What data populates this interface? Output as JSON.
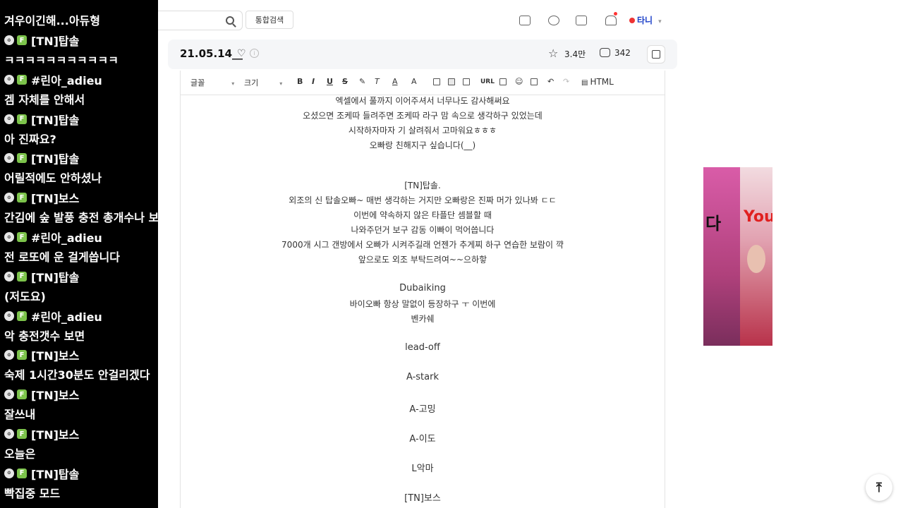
{
  "chat": {
    "top_partial": "겨우이긴해...아듀형",
    "messages": [
      {
        "user": "[TN]탑솔",
        "text": "ㅋㅋㅋㅋㅋㅋㅋㅋㅋㅋㅋ"
      },
      {
        "user": "#린아_adieu",
        "text": "겜 자체를 안해서"
      },
      {
        "user": "[TN]탑솔",
        "text": "아 진짜요?"
      },
      {
        "user": "[TN]탑솔",
        "text": "어릴적에도 안하셨나"
      },
      {
        "user": "[TN]보스",
        "text": "간김에 숲 발풍 충전 총개수나 보고와야겠다"
      },
      {
        "user": "#린아_adieu",
        "text": "전 로또에 운 걸게씁니다"
      },
      {
        "user": "[TN]탑솔",
        "text": "(저도요)"
      },
      {
        "user": "#린아_adieu",
        "text": "악 충전갯수 보면"
      },
      {
        "user": "[TN]보스",
        "text": "숙제 1시간30분도 안걸리겠다"
      },
      {
        "user": "[TN]보스",
        "text": "잘쓰내"
      },
      {
        "user": "[TN]보스",
        "text": "오늘은"
      },
      {
        "user": "[TN]탑솔",
        "text": "빡집중 모드"
      }
    ]
  },
  "topbar": {
    "search_button": "통합검색",
    "user_name": "타니"
  },
  "post": {
    "title": "21.05.14__",
    "likes": "3.4만",
    "views": "342"
  },
  "toolbar": {
    "font": "글꼴",
    "size": "크기",
    "bold": "B",
    "italic": "I",
    "underline": "U",
    "strike": "S",
    "url": "URL",
    "html": "HTML"
  },
  "content_lines": [
    "엑셀에서 풀까지 이어주셔서 너무나도 감사해써요",
    "오셨으면 조케따 들려주면 조케따 라구 맘 속으로 생각하구 있었는데",
    "시작하자마자 기 살려줘서 고마워요ㅎㅎㅎ",
    "오빠랑 친해지구 싶습니다(__)",
    "[TN]탑솔.",
    "외조의 신 탑솔오빠~ 매번 생각하는 거지만 오빠랑은 진짜 머가 있나봐 ㄷㄷ",
    "이번에 약속하지 않은 타플단 셈블할 때",
    "나와주던거 보구 감동 이빠이 먹어씁니다",
    "7000개 시그 갠방에서 오빠가 시켜주길래 언젠가 추게찌 하구 연습한 보람이 꺅",
    "앞으로도 외조 부탁드려여~~으하핳",
    "Dubaiking",
    "바이오빠 항상 말없이 등장하구 ㅜ 이번에",
    "벤카쉐",
    "lead-off",
    "A-stark",
    "A-고밍",
    "A-이도",
    "L악마",
    "[TN]보스"
  ],
  "ad": {
    "text_left": "다",
    "text_right": "You"
  },
  "colors": {
    "accent": "#1a3ec8",
    "f_badge": "#7cc34b",
    "chat_bg": "#000000"
  }
}
